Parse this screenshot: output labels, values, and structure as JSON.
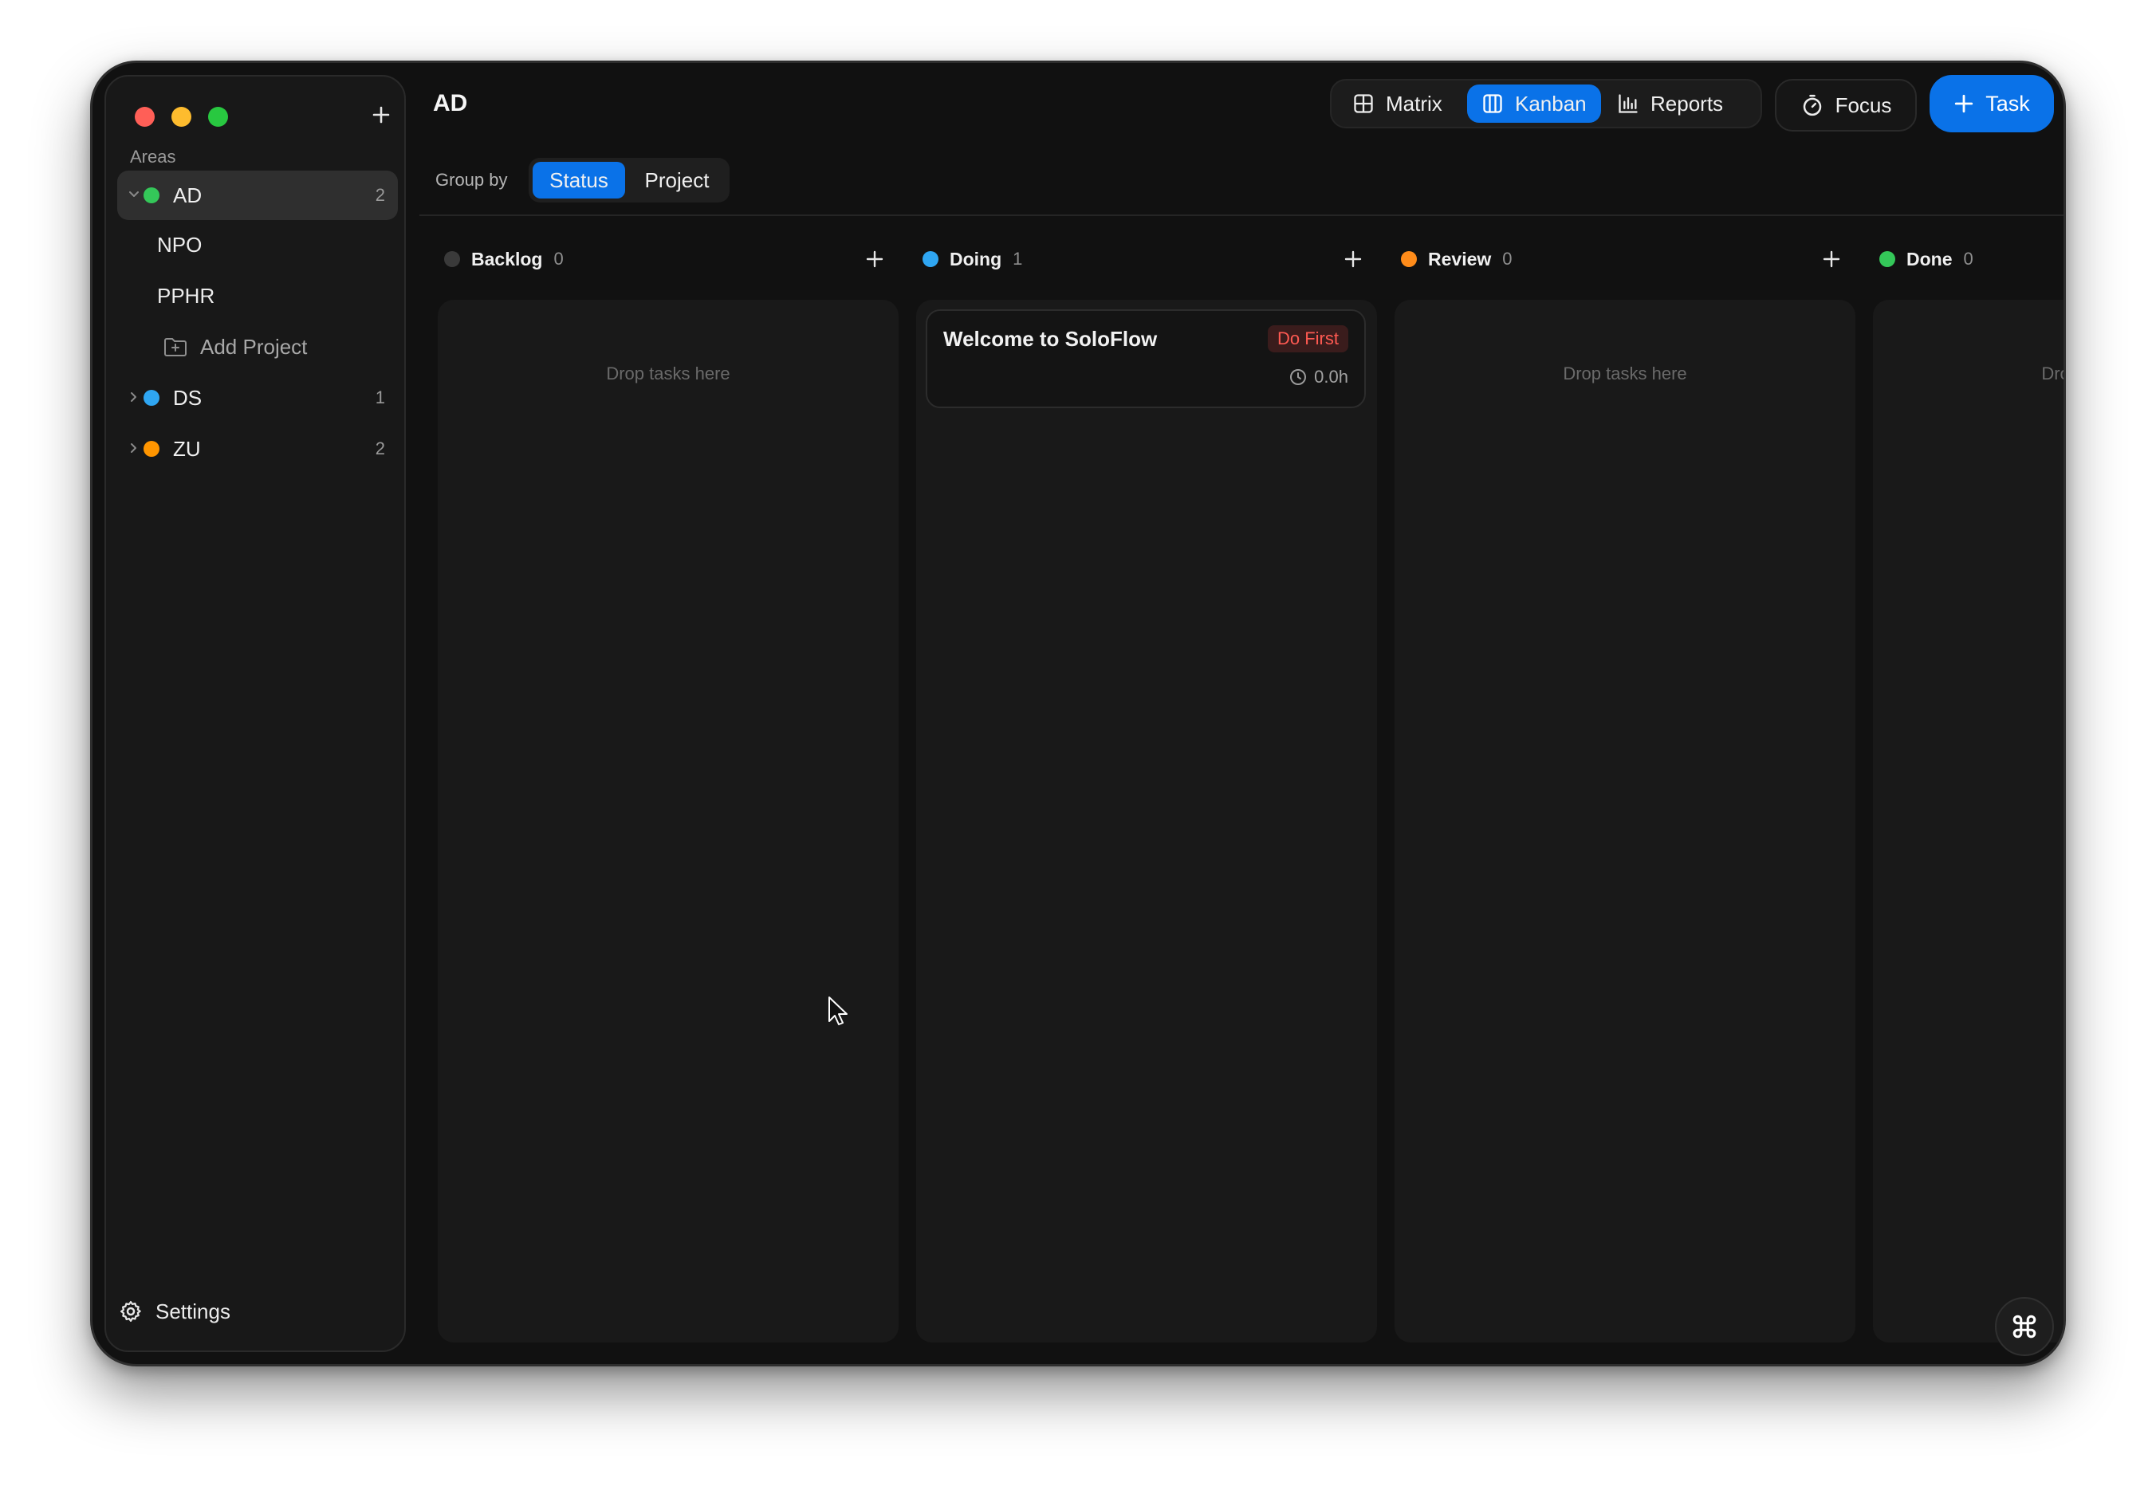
{
  "sidebar": {
    "areas_label": "Areas",
    "items": [
      {
        "label": "AD",
        "count": "2",
        "color": "#34c759",
        "expanded": true
      },
      {
        "label": "DS",
        "count": "1",
        "color": "#2fa6f2",
        "expanded": false
      },
      {
        "label": "ZU",
        "count": "2",
        "color": "#ff9500",
        "expanded": false
      }
    ],
    "projects": [
      "NPO",
      "PPHR"
    ],
    "add_project_label": "Add Project",
    "settings_label": "Settings"
  },
  "header": {
    "title": "AD",
    "views": [
      {
        "label": "Matrix",
        "icon": "grid-icon",
        "active": false
      },
      {
        "label": "Kanban",
        "icon": "kanban-icon",
        "active": true
      },
      {
        "label": "Reports",
        "icon": "chart-icon",
        "active": false
      }
    ],
    "focus_label": "Focus",
    "task_label": "Task",
    "accent_color": "#0a72e8"
  },
  "group_by": {
    "label": "Group by",
    "options": [
      {
        "label": "Status",
        "active": true
      },
      {
        "label": "Project",
        "active": false
      }
    ]
  },
  "columns": [
    {
      "title": "Backlog",
      "count": "0",
      "color": "#3a3a3a",
      "empty_text": "Drop tasks here"
    },
    {
      "title": "Doing",
      "count": "1",
      "color": "#2fa6f2",
      "empty_text": ""
    },
    {
      "title": "Review",
      "count": "0",
      "color": "#ff8c1a",
      "empty_text": "Drop tasks here"
    },
    {
      "title": "Done",
      "count": "0",
      "color": "#34c759",
      "empty_text": "Drop tasks here"
    }
  ],
  "cards": [
    {
      "title": "Welcome to SoloFlow",
      "badge": "Do First",
      "time": "0.0h"
    }
  ]
}
